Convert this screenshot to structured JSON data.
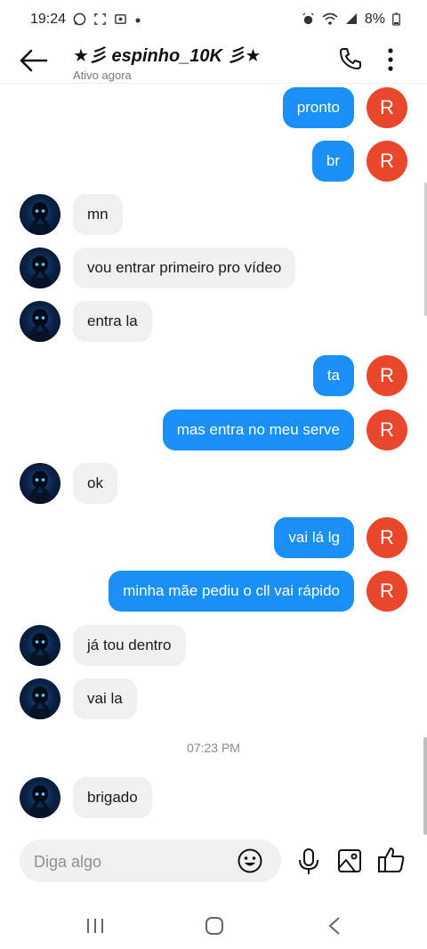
{
  "status_bar": {
    "time": "19:24",
    "battery": "8%"
  },
  "header": {
    "title": "★彡 espinho_10K 彡★",
    "subtitle": "Ativo agora"
  },
  "messages": [
    {
      "text": "pronto",
      "outgoing": true,
      "avatar_letter": "R"
    },
    {
      "text": "br",
      "outgoing": true,
      "avatar_letter": "R"
    },
    {
      "text": "mn",
      "outgoing": false
    },
    {
      "text": "vou entrar primeiro pro vídeo",
      "outgoing": false
    },
    {
      "text": "entra la",
      "outgoing": false
    },
    {
      "text": "ta",
      "outgoing": true,
      "avatar_letter": "R"
    },
    {
      "text": "mas entra no meu serve",
      "outgoing": true,
      "avatar_letter": "R"
    },
    {
      "text": "ok",
      "outgoing": false
    },
    {
      "text": "vai lá lg",
      "outgoing": true,
      "avatar_letter": "R"
    },
    {
      "text": "minha mãe pediu o cll vai rápido",
      "outgoing": true,
      "avatar_letter": "R"
    },
    {
      "text": "já tou dentro",
      "outgoing": false
    },
    {
      "text": "vai la",
      "outgoing": false
    },
    {
      "text": "brigado",
      "outgoing": false
    }
  ],
  "timestamp": "07:23 PM",
  "composer": {
    "placeholder": "Diga algo"
  },
  "colors": {
    "outgoing_bubble": "#1a8ff5",
    "incoming_bubble": "#f0f0f2",
    "user_avatar": "#e8472c"
  },
  "icons": {
    "back": "arrow-left-icon",
    "call": "phone-icon",
    "more": "more-vertical-icon",
    "emoji": "emoji-icon",
    "mic": "microphone-icon",
    "gallery": "image-icon",
    "like": "thumbs-up-icon"
  }
}
